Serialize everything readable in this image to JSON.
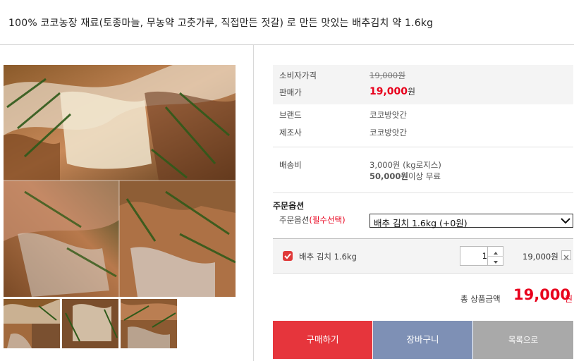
{
  "product": {
    "title": "100% 코코농장 재료(토종마늘, 무농약 고춧가루, 직접만든 젓갈) 로 만든 맛있는 배추김치 약 1.6kg"
  },
  "gallery": {
    "thumbnails": [
      "thumb-1",
      "thumb-2",
      "thumb-3"
    ]
  },
  "info": {
    "consumer_price_label": "소비자가격",
    "consumer_price": "19,000원",
    "sale_price_label": "판매가",
    "sale_price_number": "19,000",
    "sale_price_unit": "원",
    "brand_label": "브랜드",
    "brand": "코코방앗간",
    "maker_label": "제조사",
    "maker": "코코방앗간",
    "shipping_label": "배송비",
    "shipping_fee": "3,000원 (kg로지스)",
    "free_threshold": "50,000원",
    "free_suffix": "이상 무료"
  },
  "options": {
    "heading": "주문옵션",
    "label": "주문옵션",
    "required": "(필수선택)",
    "selected": "배추 김치 1.6kg (+0원)"
  },
  "selected_item": {
    "name": "배추 김치 1.6kg",
    "quantity": "1",
    "price": "19,000원",
    "checked": true
  },
  "total": {
    "label": "총 상품금액",
    "amount": "19,000",
    "unit": "원"
  },
  "actions": {
    "buy": "구매하기",
    "cart": "장바구니",
    "list": "목록으로"
  },
  "colors": {
    "accent_red": "#e8001c",
    "buy_button": "#e6353c",
    "cart_button": "#7e90b5",
    "list_button": "#a9a9a9"
  }
}
